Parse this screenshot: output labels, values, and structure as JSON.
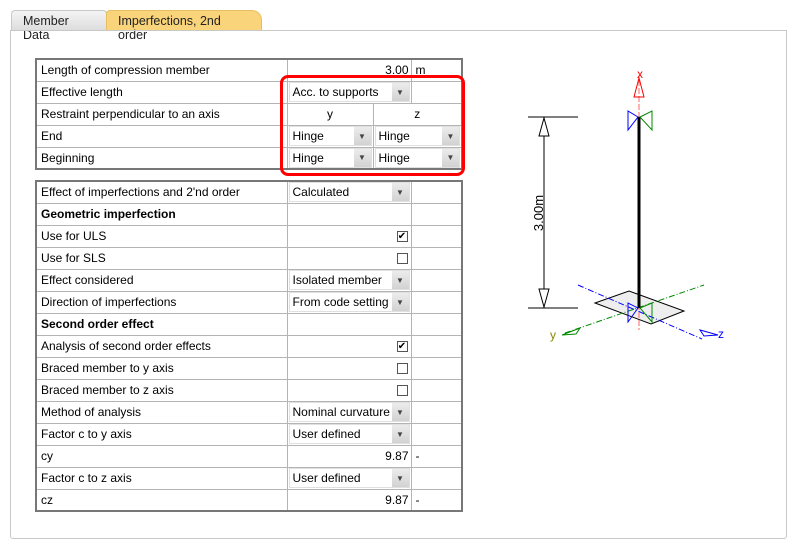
{
  "tabs": [
    {
      "label": "Member Data"
    },
    {
      "label": "Imperfections, 2nd order",
      "active": true
    }
  ],
  "top": {
    "length_label": "Length of compression member",
    "length_value": "3.00",
    "length_unit": "m",
    "eff_label": "Effective length",
    "eff_value": "Acc. to supports",
    "restraint_label": "Restraint perpendicular to an axis",
    "col_y": "y",
    "col_z": "z",
    "end_label": "End",
    "end_y": "Hinge",
    "end_z": "Hinge",
    "beg_label": "Beginning",
    "beg_y": "Hinge",
    "beg_z": "Hinge"
  },
  "rows": [
    {
      "label": "Effect of imperfections and 2'nd order",
      "type": "dropdown",
      "value": "Calculated"
    },
    {
      "label": "Geometric imperfection",
      "type": "header"
    },
    {
      "label": "Use for ULS",
      "type": "check",
      "checked": true
    },
    {
      "label": "Use for SLS",
      "type": "check",
      "checked": false
    },
    {
      "label": "Effect considered",
      "type": "dropdown",
      "value": "Isolated member"
    },
    {
      "label": "Direction of imperfections",
      "type": "dropdown",
      "value": "From code setting"
    },
    {
      "label": "Second order effect",
      "type": "header"
    },
    {
      "label": "Analysis of second order effects",
      "type": "check",
      "checked": true
    },
    {
      "label": "Braced member to y axis",
      "type": "check",
      "checked": false
    },
    {
      "label": "Braced member to z axis",
      "type": "check",
      "checked": false
    },
    {
      "label": "Method of analysis",
      "type": "dropdown",
      "value": "Nominal curvature"
    },
    {
      "label": "Factor c to y axis",
      "type": "dropdown",
      "value": "User defined"
    },
    {
      "label": "cy",
      "type": "number",
      "value": "9.87",
      "unit": "-"
    },
    {
      "label": "Factor c to z axis",
      "type": "dropdown",
      "value": "User defined"
    },
    {
      "label": "cz",
      "type": "number",
      "value": "9.87",
      "unit": "-"
    }
  ],
  "drawing": {
    "dimension": "3.00m",
    "axis_x": "x",
    "axis_y": "y",
    "axis_z": "z"
  }
}
